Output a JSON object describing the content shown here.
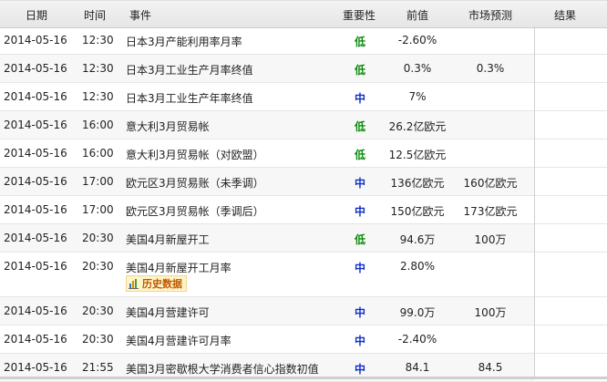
{
  "header": {
    "date": "日期",
    "time": "时间",
    "event": "事件",
    "importance": "重要性",
    "previous": "前值",
    "forecast": "市场预测",
    "result": "结果"
  },
  "history_label": "历史数据",
  "colors": {
    "low": "#0a8a0a",
    "mid": "#1030c8"
  },
  "rows": [
    {
      "date": "2014-05-16",
      "time": "12:30",
      "event": "日本3月产能利用率月率",
      "importance": "低",
      "previous": "-2.60%",
      "forecast": "",
      "result": ""
    },
    {
      "date": "2014-05-16",
      "time": "12:30",
      "event": "日本3月工业生产月率终值",
      "importance": "低",
      "previous": "0.3%",
      "forecast": "0.3%",
      "result": ""
    },
    {
      "date": "2014-05-16",
      "time": "12:30",
      "event": "日本3月工业生产年率终值",
      "importance": "中",
      "previous": "7%",
      "forecast": "",
      "result": ""
    },
    {
      "date": "2014-05-16",
      "time": "16:00",
      "event": "意大利3月贸易帐",
      "importance": "低",
      "previous": "26.2亿欧元",
      "forecast": "",
      "result": ""
    },
    {
      "date": "2014-05-16",
      "time": "16:00",
      "event": "意大利3月贸易帐（对欧盟）",
      "importance": "低",
      "previous": "12.5亿欧元",
      "forecast": "",
      "result": ""
    },
    {
      "date": "2014-05-16",
      "time": "17:00",
      "event": "欧元区3月贸易账（未季调）",
      "importance": "中",
      "previous": "136亿欧元",
      "forecast": "160亿欧元",
      "result": ""
    },
    {
      "date": "2014-05-16",
      "time": "17:00",
      "event": "欧元区3月贸易帐（季调后）",
      "importance": "中",
      "previous": "150亿欧元",
      "forecast": "173亿欧元",
      "result": ""
    },
    {
      "date": "2014-05-16",
      "time": "20:30",
      "event": "美国4月新屋开工",
      "importance": "低",
      "previous": "94.6万",
      "forecast": "100万",
      "result": ""
    },
    {
      "date": "2014-05-16",
      "time": "20:30",
      "event": "美国4月新屋开工月率",
      "importance": "中",
      "previous": "2.80%",
      "forecast": "",
      "result": "",
      "history": true
    },
    {
      "date": "2014-05-16",
      "time": "20:30",
      "event": "美国4月营建许可",
      "importance": "中",
      "previous": "99.0万",
      "forecast": "100万",
      "result": ""
    },
    {
      "date": "2014-05-16",
      "time": "20:30",
      "event": "美国4月营建许可月率",
      "importance": "中",
      "previous": "-2.40%",
      "forecast": "",
      "result": ""
    },
    {
      "date": "2014-05-16",
      "time": "21:55",
      "event": "美国3月密歇根大学消费者信心指数初值",
      "importance": "中",
      "previous": "84.1",
      "forecast": "84.5",
      "result": ""
    }
  ]
}
